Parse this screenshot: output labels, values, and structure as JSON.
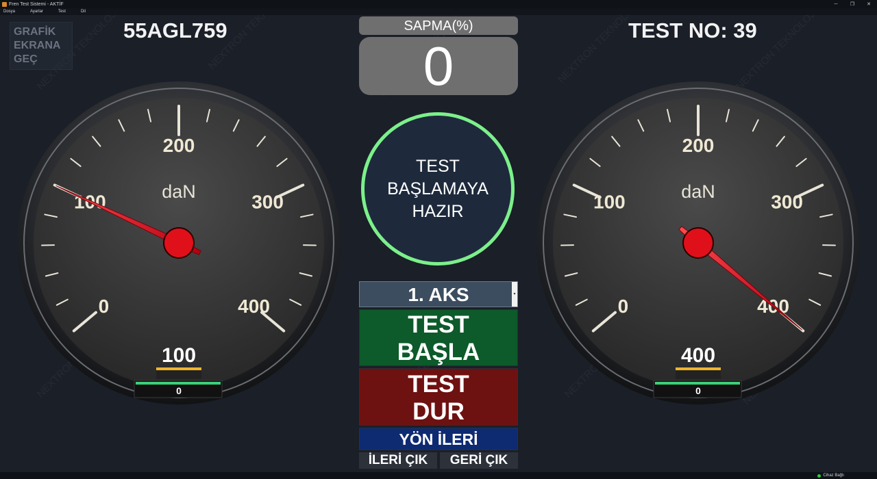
{
  "window": {
    "title": "Fren Test Sistemi - AKTİF",
    "controls": {
      "minimize": "─",
      "maximize": "❐",
      "close": "✕"
    }
  },
  "menu": [
    "Dosya",
    "Ayarlar",
    "Test",
    "Dil"
  ],
  "watermark_text": "NEXTRON TEKNOLOJİ",
  "graph_button": {
    "line1": "GRAFİK",
    "line2": "EKRANA",
    "line3": "GEÇ"
  },
  "plate": "55AGL759",
  "test_no": "TEST NO: 39",
  "deviation": {
    "label": "SAPMA(%)",
    "value": "0"
  },
  "status": {
    "line1": "TEST",
    "line2": "BAŞLAMAYA",
    "line3": "HAZIR",
    "ring_color": "#7cf08a"
  },
  "axle_select": {
    "value": "1. AKS",
    "arrow": "▾"
  },
  "buttons": {
    "start_line1": "TEST",
    "start_line2": "BAŞLA",
    "stop_line1": "TEST",
    "stop_line2": "DUR",
    "direction": "YÖN İLERİ",
    "forward_exit": "İLERİ ÇIK",
    "back_exit": "GERİ ÇIK"
  },
  "gauge_scale": {
    "min": 0,
    "max": 400,
    "labels": [
      "0",
      "100",
      "200",
      "300",
      "400"
    ],
    "unit": "daN"
  },
  "gauges": [
    {
      "id": "left",
      "value": 100,
      "display": "100",
      "bar_value": "0"
    },
    {
      "id": "right",
      "value": 400,
      "display": "400",
      "bar_value": "0"
    }
  ],
  "statusbar": {
    "connection": "Cihaz Bağlı",
    "connection_color": "#2ecc40"
  },
  "colors": {
    "start": "#0d5a2a",
    "stop": "#6e1111",
    "direction": "#0e2b72",
    "needle": "#e0101a",
    "accent_bar": "#f0b429",
    "green_bar": "#3ad17a"
  }
}
